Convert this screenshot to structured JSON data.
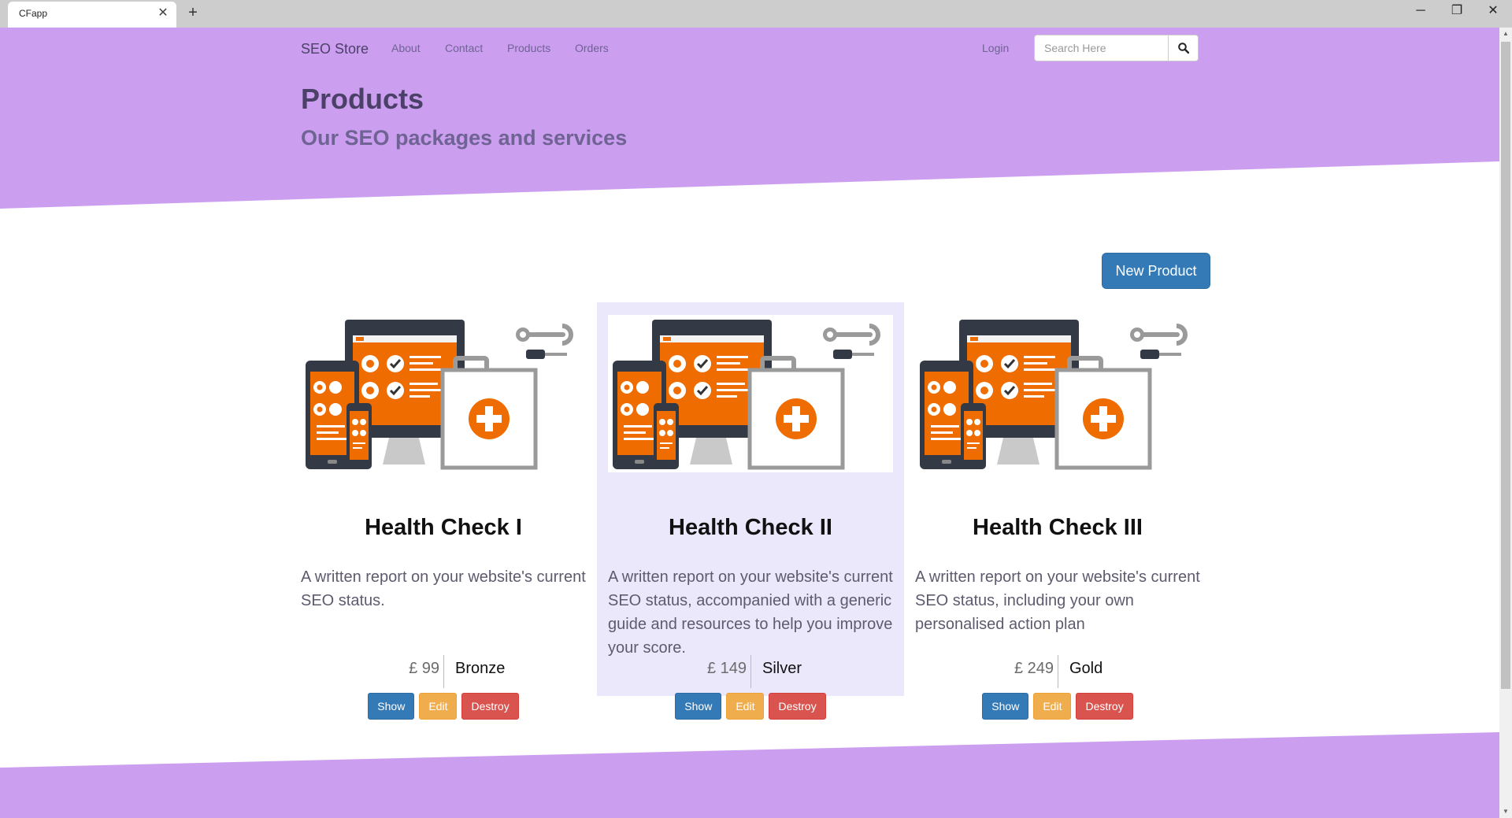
{
  "browser": {
    "tab_title": "CFapp",
    "tab_close": "✕",
    "new_tab": "+",
    "minimize": "─",
    "restore": "❐",
    "close": "✕"
  },
  "navbar": {
    "brand": "SEO Store",
    "links": [
      "About",
      "Contact",
      "Products",
      "Orders"
    ],
    "login": "Login",
    "search_placeholder": "Search Here"
  },
  "header": {
    "title": "Products",
    "subtitle": "Our SEO packages and services"
  },
  "actions": {
    "new_product": "New Product"
  },
  "products": [
    {
      "title": "Health Check I",
      "description": "A written report on your website's current SEO status.",
      "price": "£ 99",
      "tier": "Bronze",
      "buttons": {
        "show": "Show",
        "edit": "Edit",
        "destroy": "Destroy"
      }
    },
    {
      "title": "Health Check II",
      "description": "A written report on your website's current SEO status, accompanied with a generic guide and resources to help you improve your score.",
      "price": "£ 149",
      "tier": "Silver",
      "buttons": {
        "show": "Show",
        "edit": "Edit",
        "destroy": "Destroy"
      }
    },
    {
      "title": "Health Check III",
      "description": "A written report on your website's current SEO status, including your own personalised action plan",
      "price": "£ 249",
      "tier": "Gold",
      "buttons": {
        "show": "Show",
        "edit": "Edit",
        "destroy": "Destroy"
      }
    }
  ],
  "colors": {
    "header_bg": "#cb9ef0",
    "primary": "#337ab7",
    "warning": "#f0ad4e",
    "danger": "#d9534f",
    "card_highlight": "#ebe8fc",
    "illustration_orange": "#ef6c00",
    "illustration_dark": "#333a45"
  },
  "icons": {
    "search": "search-icon",
    "product_image": "seo-health-check-illustration"
  }
}
